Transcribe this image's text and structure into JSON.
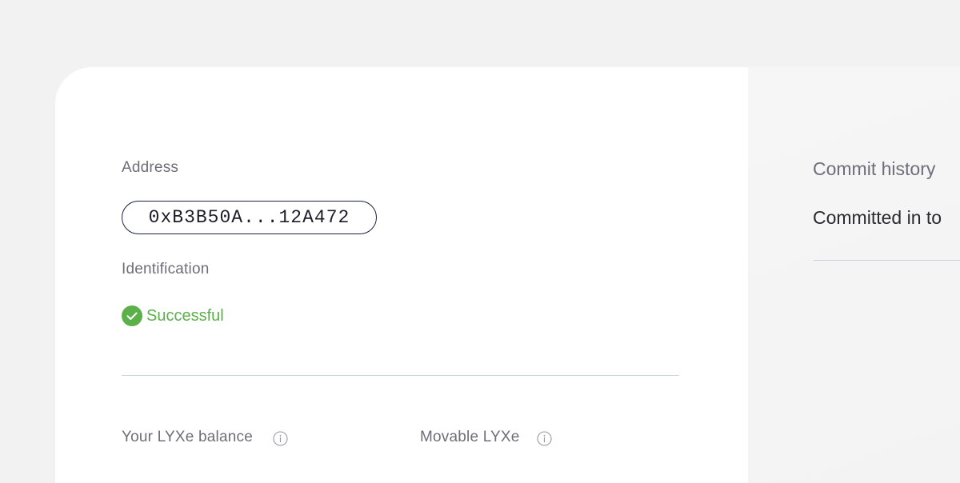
{
  "identity": {
    "address_label": "Address",
    "address_value": "0xB3B50A...12A472",
    "identification_label": "Identification",
    "identification_status": "Successful"
  },
  "balances": {
    "lyxe_balance_label": "Your LYXe balance",
    "movable_lyxe_label": "Movable LYXe"
  },
  "commit_history": {
    "title": "Commit history",
    "committed_label": "Committed in to"
  },
  "icons": {
    "status": "check-circle-icon",
    "info": "info-icon"
  },
  "colors": {
    "success": "#5bb04a",
    "address_border": "#1c2340",
    "divider": "#c9d6e0"
  }
}
